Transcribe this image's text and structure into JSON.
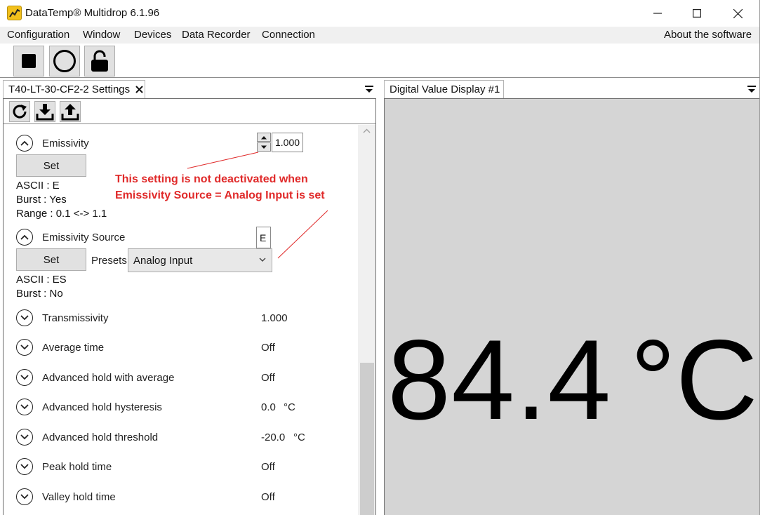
{
  "window": {
    "title": "DataTemp® Multidrop 6.1.96"
  },
  "menu": {
    "items": [
      "Configuration",
      "Window",
      "Devices",
      "Data Recorder",
      "Connection"
    ],
    "about": "About the software"
  },
  "toolbar": {
    "buttons": [
      "stop-icon",
      "record-icon",
      "unlock-icon"
    ]
  },
  "settings_panel": {
    "tab_title": "T40-LT-30-CF2-2 Settings",
    "mini_toolbar": [
      "refresh-icon",
      "download-icon",
      "upload-icon"
    ],
    "emissivity": {
      "label": "Emissivity",
      "value": "1.000",
      "set_label": "Set",
      "ascii": "ASCII : E",
      "burst": "Burst : Yes",
      "range": "Range : 0.1 <-> 1.1"
    },
    "emissivity_source": {
      "label": "Emissivity Source",
      "value": "E",
      "set_label": "Set",
      "presets_label": "Presets",
      "selected": "Analog Input",
      "ascii": "ASCII : ES",
      "burst": "Burst : No"
    },
    "items": [
      {
        "label": "Transmissivity",
        "value": "1.000",
        "unit": ""
      },
      {
        "label": "Average time",
        "value": "Off",
        "unit": ""
      },
      {
        "label": "Advanced hold with average",
        "value": "Off",
        "unit": ""
      },
      {
        "label": "Advanced hold hysteresis",
        "value": "0.0",
        "unit": "°C"
      },
      {
        "label": "Advanced hold threshold",
        "value": "-20.0",
        "unit": "°C"
      },
      {
        "label": "Peak hold time",
        "value": "Off",
        "unit": ""
      },
      {
        "label": "Valley hold time",
        "value": "Off",
        "unit": ""
      }
    ]
  },
  "annotation": {
    "line1": "This setting is not deactivated when",
    "line2": "Emissivity Source = Analog Input is set",
    "color": "#e02a2a"
  },
  "display_panel": {
    "tab_title": "Digital Value Display #1",
    "value": "84.4",
    "unit": "°C",
    "background": "#d5d5d5"
  }
}
